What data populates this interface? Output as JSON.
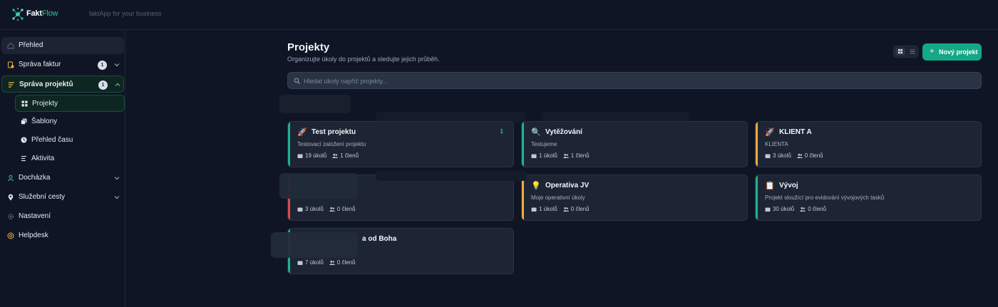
{
  "header": {
    "brand_part1": "Fakt",
    "brand_part2": "Flow",
    "tagline": "faktApp for your business"
  },
  "sidebar": {
    "items": [
      {
        "label": "Přehled"
      },
      {
        "label": "Správa faktur",
        "badge": "1"
      },
      {
        "label": "Správa projektů",
        "badge": "1"
      },
      {
        "label": "Docházka"
      },
      {
        "label": "Služební cesty"
      },
      {
        "label": "Nastavení"
      },
      {
        "label": "Helpdesk"
      }
    ],
    "project_subitems": [
      {
        "label": "Projekty"
      },
      {
        "label": "Šablony"
      },
      {
        "label": "Přehled času"
      },
      {
        "label": "Aktivita"
      }
    ]
  },
  "main": {
    "title": "Projekty",
    "subtitle": "Organizujte úkoly do projektů a sledujte jejich průběh.",
    "new_button": "Nový projekt",
    "search_placeholder": "Hledat úkoly napříč projekty..."
  },
  "projects": [
    {
      "emoji": "🚀",
      "name": "Test projektu",
      "desc": "Testovací založení projektu",
      "tasks": "19 úkolů",
      "members": "1 členů",
      "count": "1",
      "accent": "#1fb28d"
    },
    {
      "emoji": "🔍",
      "name": "Vytěžování",
      "desc": "Testujeme",
      "tasks": "1 úkolů",
      "members": "1 členů",
      "accent": "#1fb28d"
    },
    {
      "emoji": "🚀",
      "name": "KLIENT A",
      "desc": "KLIENTA",
      "tasks": "3 úkolů",
      "members": "0 členů",
      "accent": "#f0a93a"
    },
    {
      "emoji": "",
      "name": "",
      "desc": "",
      "tasks": "3 úkolů",
      "members": "0 členů",
      "accent": "#e0484a"
    },
    {
      "emoji": "💡",
      "name": "Operativa JV",
      "desc": "Moje operativní úkoly",
      "tasks": "1 úkolů",
      "members": "0 členů",
      "accent": "#f0a93a"
    },
    {
      "emoji": "📋",
      "name": "Vývoj",
      "desc": "Projekt sloužící pro evidování vývojových tasků",
      "tasks": "30 úkolů",
      "members": "0 členů",
      "accent": "#1fb28d"
    },
    {
      "emoji": "",
      "name": "a od Boha",
      "desc": "",
      "tasks": "7 úkolů",
      "members": "0 členů",
      "accent": "#1fb28d"
    }
  ],
  "colors": {
    "background": "#0f1524",
    "accent": "#14a887",
    "card": "#1d2535"
  }
}
